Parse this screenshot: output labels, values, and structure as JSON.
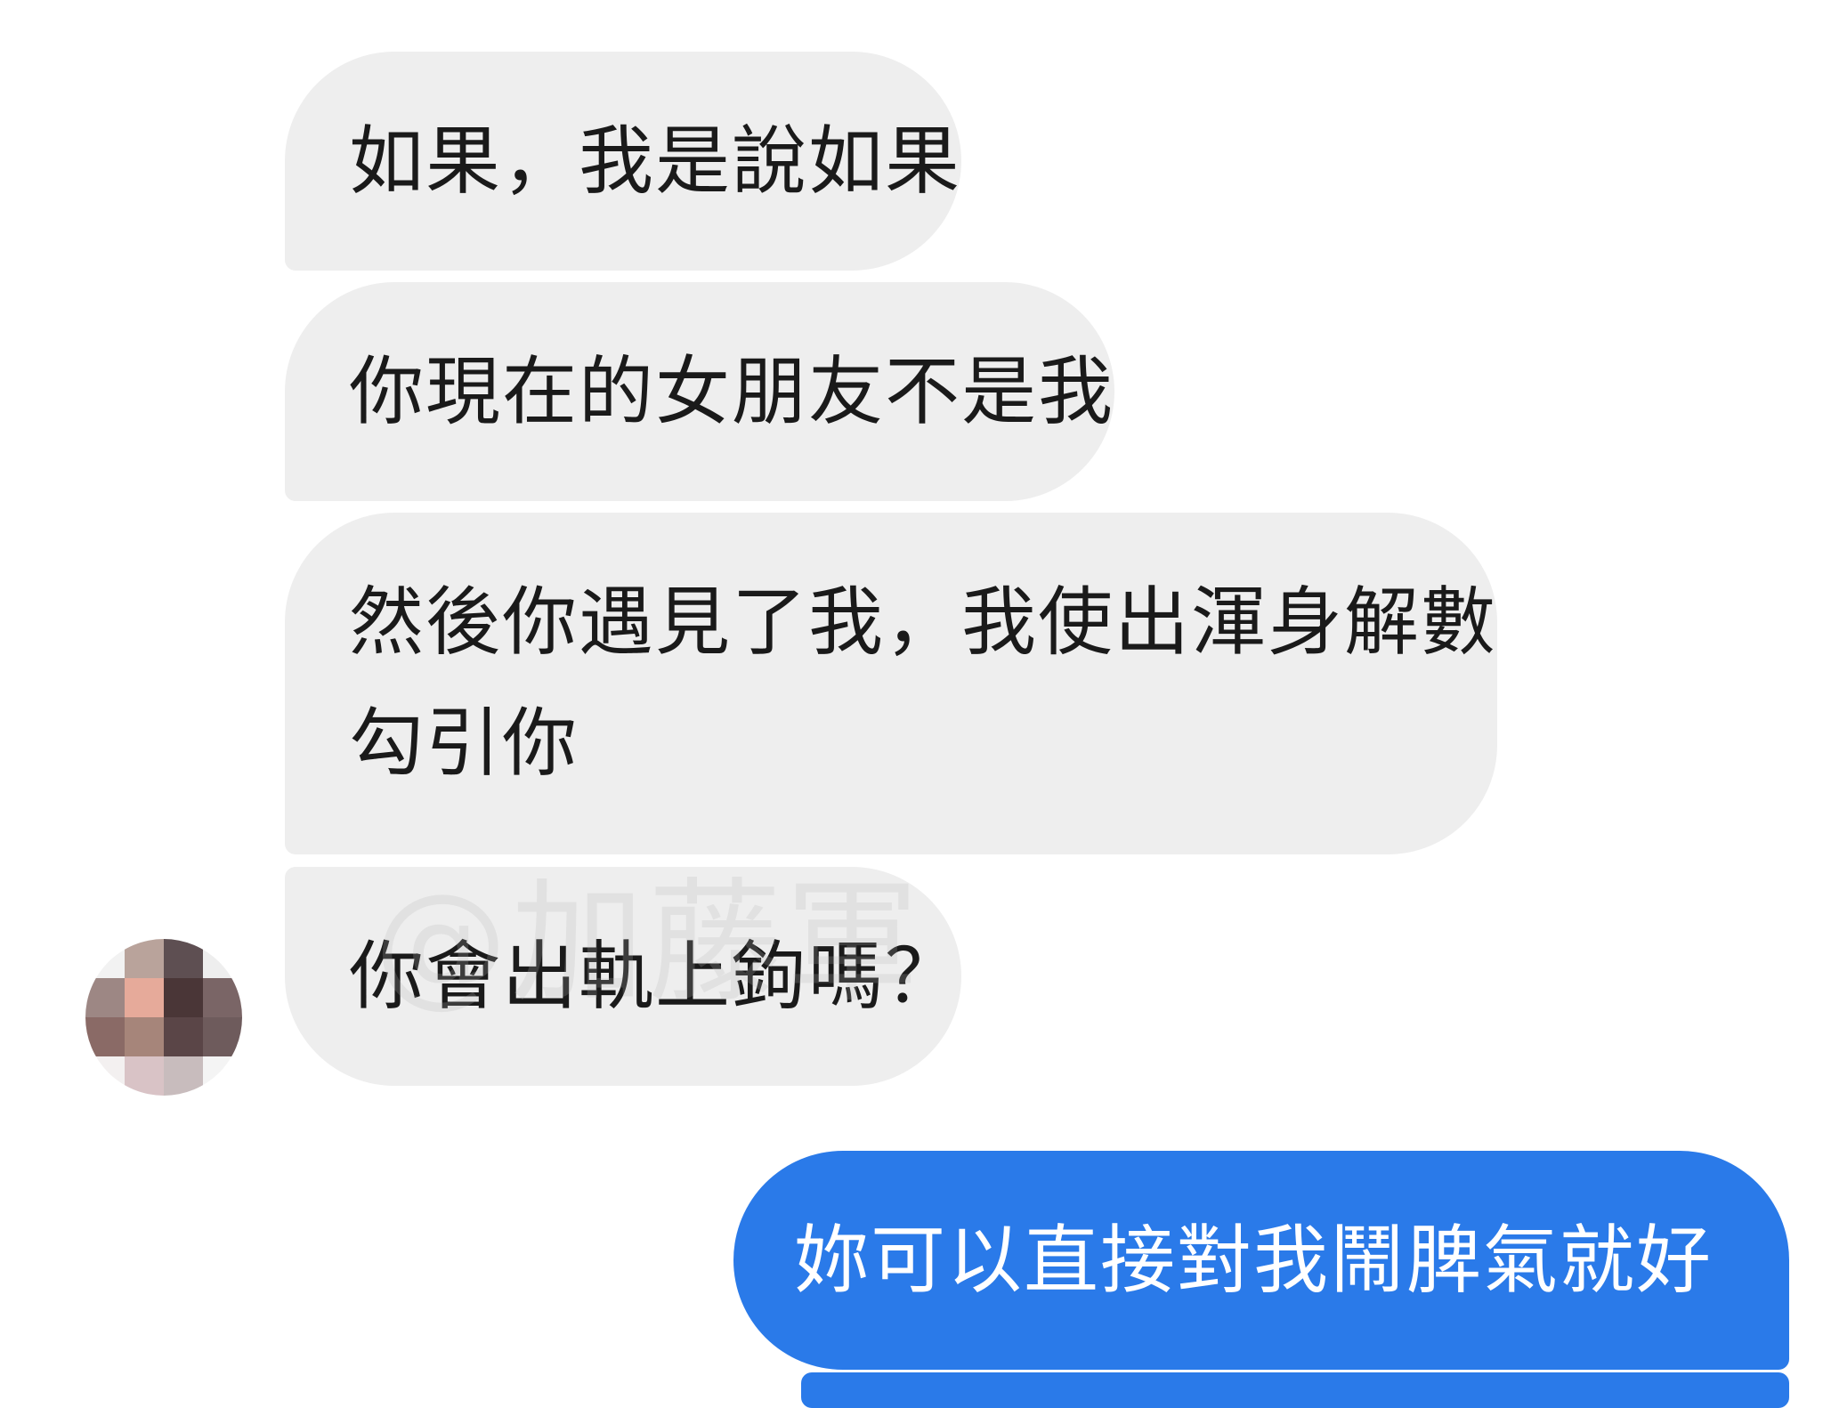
{
  "messages": [
    {
      "sender": "other",
      "lines": [
        "如果，我是說如果"
      ]
    },
    {
      "sender": "other",
      "lines": [
        "你現在的女朋友不是我"
      ]
    },
    {
      "sender": "other",
      "lines": [
        "然後你遇見了我，我使出渾身解數",
        "勾引你"
      ]
    },
    {
      "sender": "other",
      "lines": [
        "你會出軌上鉤嗎？"
      ]
    },
    {
      "sender": "me",
      "lines": [
        "妳可以直接對我鬧脾氣就好"
      ]
    }
  ],
  "watermark": "@加藤軍",
  "colors": {
    "incoming_bubble": "#eeeeee",
    "incoming_text": "#1a1a1a",
    "outgoing_bubble": "#2a7ae9",
    "outgoing_text": "#ffffff",
    "background": "#ffffff"
  }
}
